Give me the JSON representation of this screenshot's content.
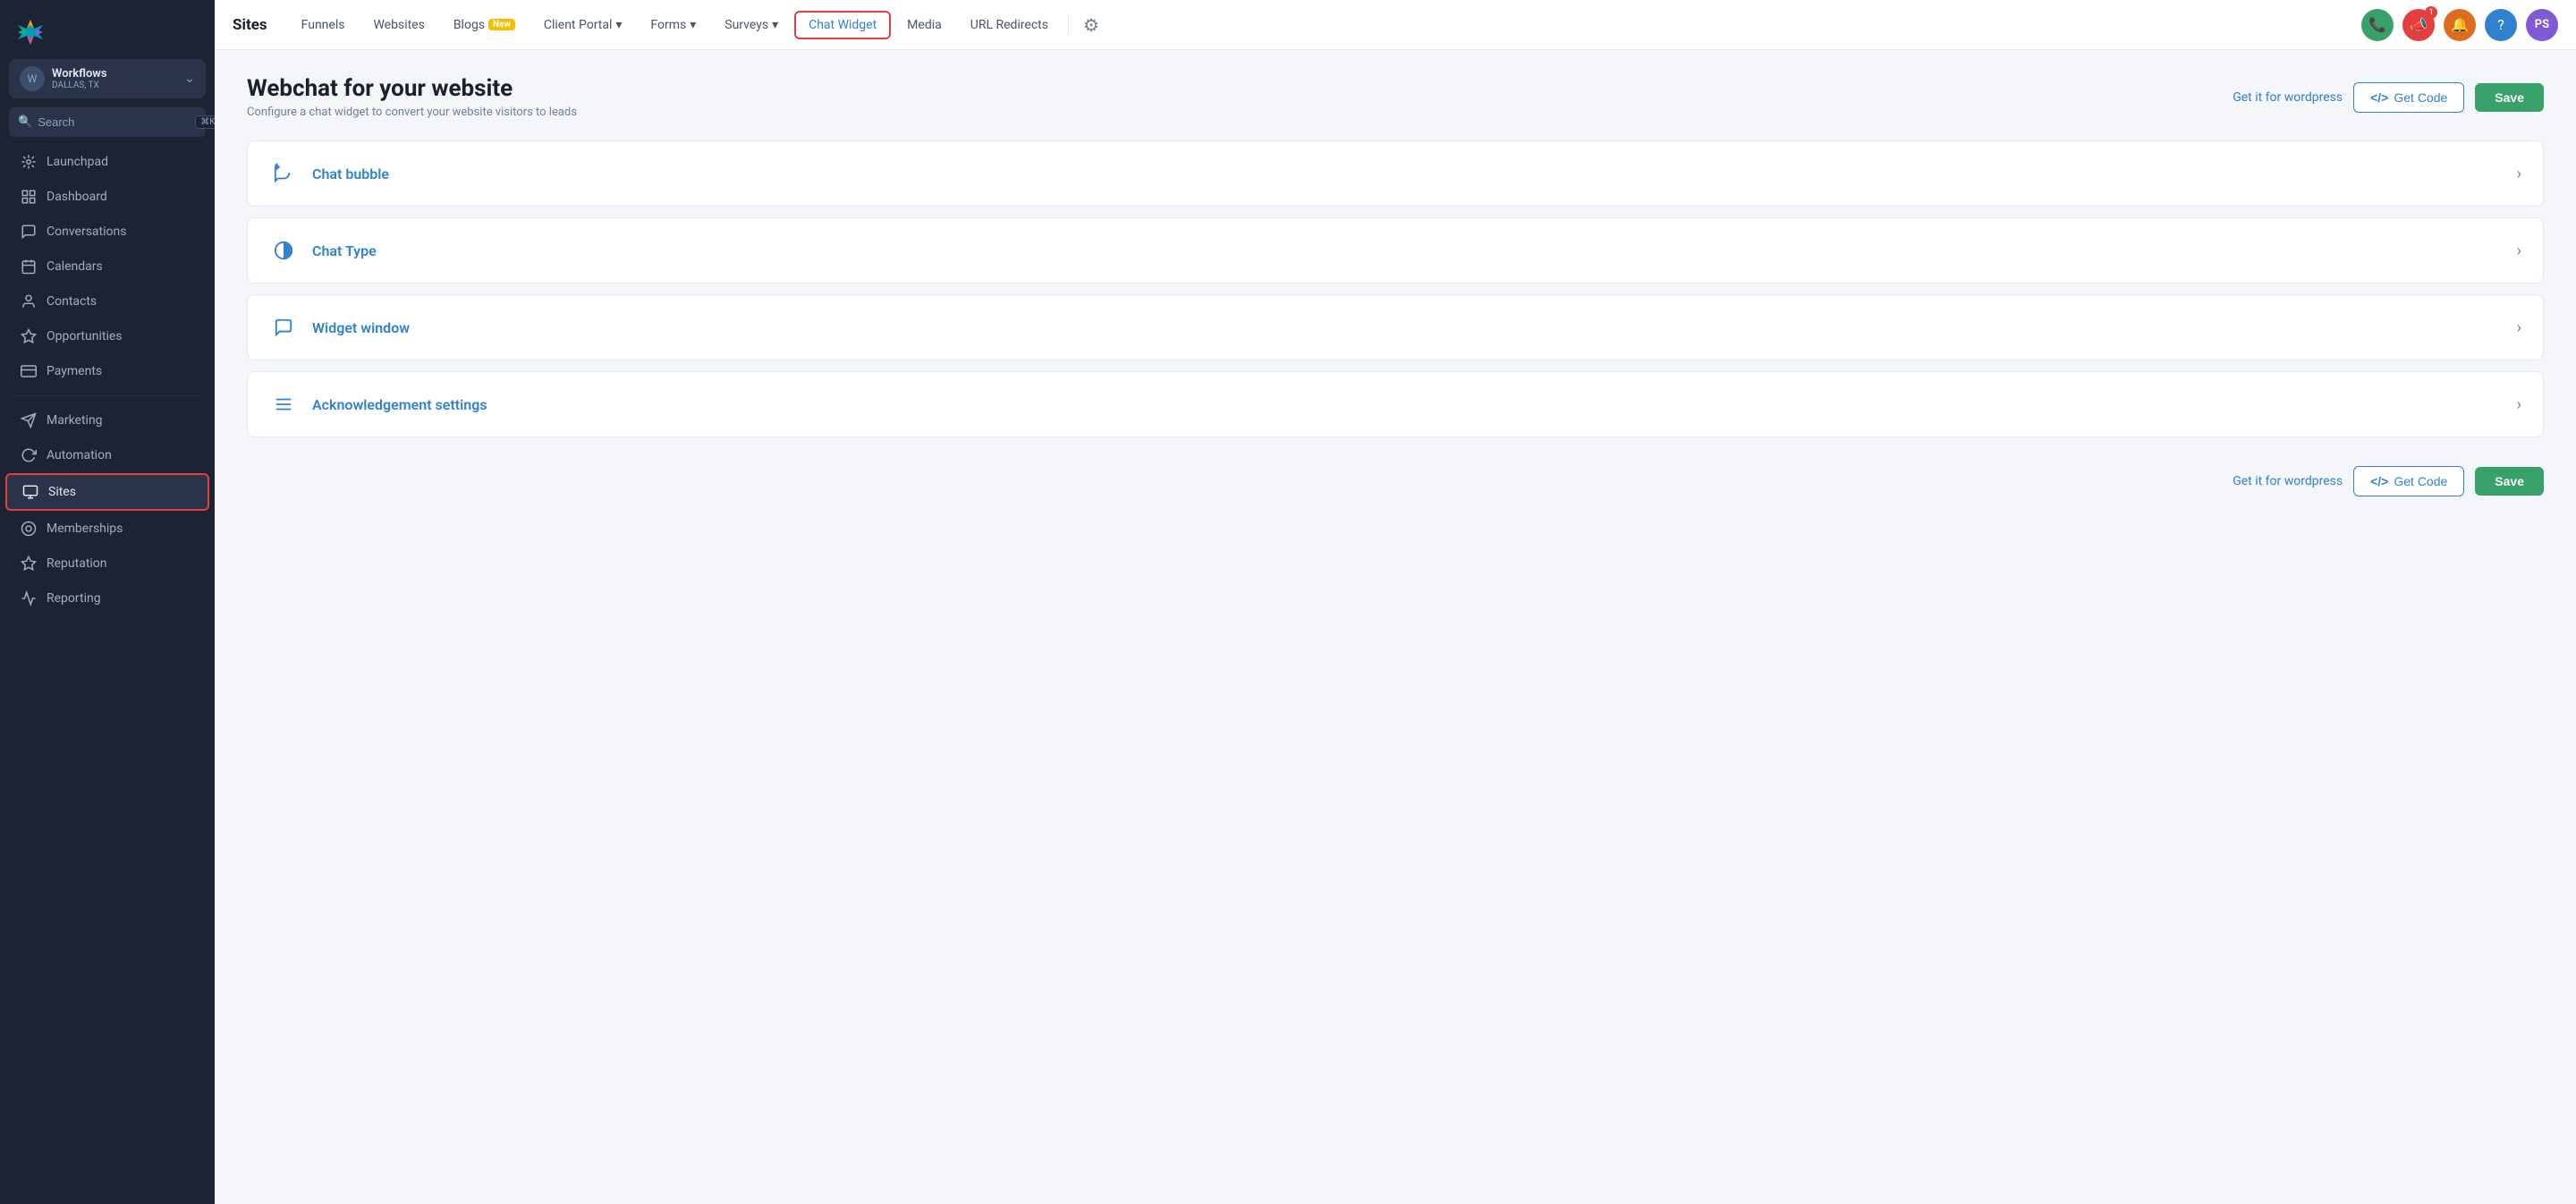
{
  "sidebar": {
    "workspace": {
      "name": "Workflows",
      "location": "DALLAS, TX"
    },
    "search": {
      "placeholder": "Search",
      "shortcut": "⌘K"
    },
    "nav_items": [
      {
        "id": "launchpad",
        "label": "Launchpad",
        "icon": "🚀",
        "active": false
      },
      {
        "id": "dashboard",
        "label": "Dashboard",
        "icon": "▦",
        "active": false
      },
      {
        "id": "conversations",
        "label": "Conversations",
        "icon": "💬",
        "active": false
      },
      {
        "id": "calendars",
        "label": "Calendars",
        "icon": "📅",
        "active": false
      },
      {
        "id": "contacts",
        "label": "Contacts",
        "icon": "👤",
        "active": false
      },
      {
        "id": "opportunities",
        "label": "Opportunities",
        "icon": "✦",
        "active": false
      },
      {
        "id": "payments",
        "label": "Payments",
        "icon": "💳",
        "active": false
      },
      {
        "id": "marketing",
        "label": "Marketing",
        "icon": "✈",
        "active": false
      },
      {
        "id": "automation",
        "label": "Automation",
        "icon": "⟳",
        "active": false
      },
      {
        "id": "sites",
        "label": "Sites",
        "icon": "🖥",
        "active": true
      },
      {
        "id": "memberships",
        "label": "Memberships",
        "icon": "◎",
        "active": false
      },
      {
        "id": "reputation",
        "label": "Reputation",
        "icon": "☆",
        "active": false
      },
      {
        "id": "reporting",
        "label": "Reporting",
        "icon": "∿",
        "active": false
      }
    ]
  },
  "topnav": {
    "brand": "Sites",
    "items": [
      {
        "id": "funnels",
        "label": "Funnels",
        "has_dropdown": false,
        "badge": null,
        "active": false,
        "highlighted": false
      },
      {
        "id": "websites",
        "label": "Websites",
        "has_dropdown": false,
        "badge": null,
        "active": false,
        "highlighted": false
      },
      {
        "id": "blogs",
        "label": "Blogs",
        "has_dropdown": false,
        "badge": "New",
        "active": false,
        "highlighted": false
      },
      {
        "id": "client-portal",
        "label": "Client Portal",
        "has_dropdown": true,
        "badge": null,
        "active": false,
        "highlighted": false
      },
      {
        "id": "forms",
        "label": "Forms",
        "has_dropdown": true,
        "badge": null,
        "active": false,
        "highlighted": false
      },
      {
        "id": "surveys",
        "label": "Surveys",
        "has_dropdown": true,
        "badge": null,
        "active": false,
        "highlighted": false
      },
      {
        "id": "chat-widget",
        "label": "Chat Widget",
        "has_dropdown": false,
        "badge": null,
        "active": true,
        "highlighted": true
      },
      {
        "id": "media",
        "label": "Media",
        "has_dropdown": false,
        "badge": null,
        "active": false,
        "highlighted": false
      },
      {
        "id": "url-redirects",
        "label": "URL Redirects",
        "has_dropdown": false,
        "badge": null,
        "active": false,
        "highlighted": false
      }
    ],
    "user_initials": "PS"
  },
  "page": {
    "title": "Webchat for your website",
    "subtitle": "Configure a chat widget to convert your website visitors to leads",
    "wordpress_link": "Get it for wordpress",
    "get_code_btn": "Get Code",
    "save_btn": "Save"
  },
  "accordion_sections": [
    {
      "id": "chat-bubble",
      "label": "Chat bubble",
      "icon": "📣"
    },
    {
      "id": "chat-type",
      "label": "Chat Type",
      "icon": "◑"
    },
    {
      "id": "widget-window",
      "label": "Widget window",
      "icon": "💬"
    },
    {
      "id": "acknowledgement-settings",
      "label": "Acknowledgement settings",
      "icon": "≡"
    }
  ]
}
